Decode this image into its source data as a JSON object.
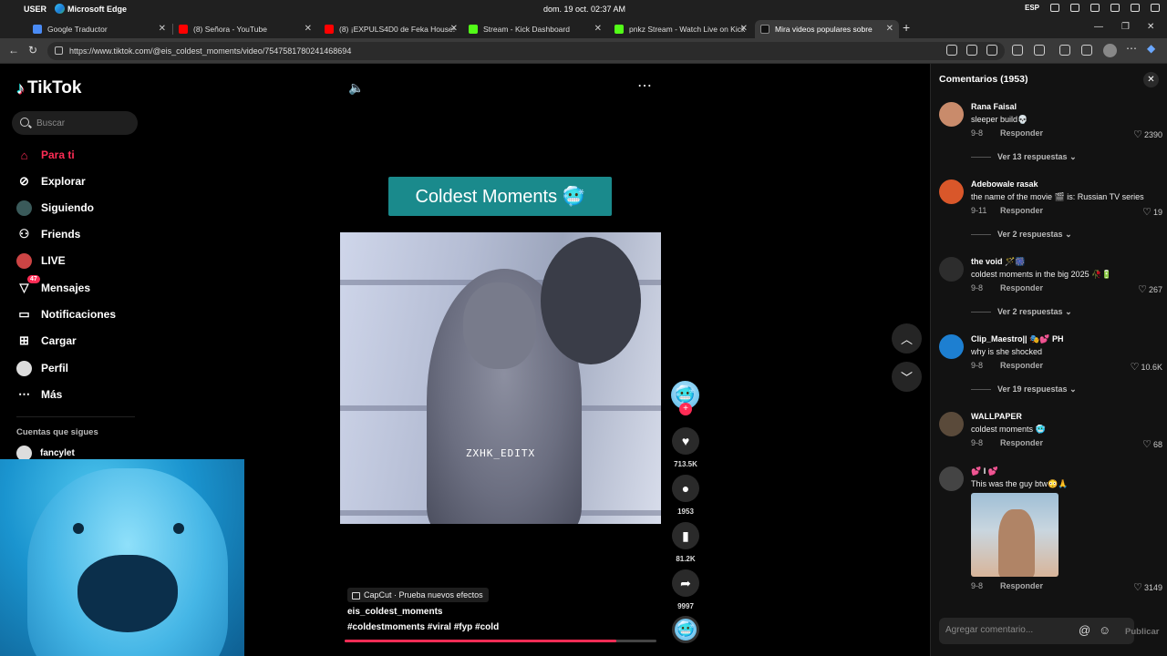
{
  "taskbar": {
    "user": "USER",
    "app": "Microsoft Edge",
    "datetime": "dom. 19 oct. 02:37 AM",
    "lang": "ESP"
  },
  "tabs": [
    {
      "label": "Google Traductor",
      "color": "#4a8bf5"
    },
    {
      "label": "(8) Señora - YouTube",
      "color": "#ff0000"
    },
    {
      "label": "(8) ¡EXPULS4D0 de Feka House!",
      "color": "#ff0000"
    },
    {
      "label": "Stream - Kick Dashboard",
      "color": "#53fc18"
    },
    {
      "label": "pnkz Stream - Watch Live on Kick",
      "color": "#53fc18"
    },
    {
      "label": "Mira videos populares sobre",
      "color": "#111111"
    }
  ],
  "address": {
    "url": "https://www.tiktok.com/@eis_coldest_moments/video/7547581780241468694"
  },
  "sidebar": {
    "brand": "TikTok",
    "search_placeholder": "Buscar",
    "items": [
      {
        "label": "Para ti",
        "icon": "home-icon"
      },
      {
        "label": "Explorar",
        "icon": "compass-icon"
      },
      {
        "label": "Siguiendo",
        "icon": "following-icon"
      },
      {
        "label": "Friends",
        "icon": "friends-icon"
      },
      {
        "label": "LIVE",
        "icon": "live-icon"
      },
      {
        "label": "Mensajes",
        "icon": "messages-icon",
        "badge": "47"
      },
      {
        "label": "Notificaciones",
        "icon": "inbox-icon"
      },
      {
        "label": "Cargar",
        "icon": "upload-icon"
      },
      {
        "label": "Perfil",
        "icon": "profile-icon"
      },
      {
        "label": "Más",
        "icon": "more-icon"
      }
    ],
    "following_heading": "Cuentas que sigues",
    "following": [
      {
        "name": "fancylet"
      }
    ]
  },
  "video": {
    "title_overlay": "Coldest Moments 🥶",
    "watermark": "ZXHK_EDITX",
    "effect": "CapCut · Prueba nuevos efectos",
    "author": "eis_coldest_moments",
    "hashtags": "#coldestmoments  #viral  #fyp  #cold",
    "progress": 0.87
  },
  "actions": {
    "likes": "713.5K",
    "comments": "1953",
    "saves": "81.2K",
    "shares": "9997"
  },
  "comments": {
    "header": "Comentarios (1953)",
    "reply_label": "Responder",
    "items": [
      {
        "name": "Rana Faisal",
        "text": "sleeper build💀",
        "date": "9-8",
        "likes": "2390",
        "more": "Ver 13 respuestas",
        "avatar": "#c98b6b"
      },
      {
        "name": "Adebowale rasak",
        "text": "the name of the movie 🎬 is: Russian TV series",
        "date": "9-11",
        "likes": "19",
        "more": "Ver 2 respuestas",
        "avatar": "#d9572a"
      },
      {
        "name": "the void 🪄🎆",
        "text": "coldest moments in the big 2025 🥀🔋",
        "date": "9-8",
        "likes": "267",
        "more": "Ver 2 respuestas",
        "avatar": "#2d2d2d"
      },
      {
        "name": "Clip_Maestro|| 🎭💕 PH",
        "text": "why is she shocked",
        "date": "9-8",
        "likes": "10.6K",
        "more": "Ver 19 respuestas",
        "avatar": "#1d7fd1"
      },
      {
        "name": "WALLPAPER",
        "text": "coldest moments 🥶",
        "date": "9-8",
        "likes": "68",
        "more": "",
        "avatar": "#5a4a3a"
      },
      {
        "name": "💕 I 💕",
        "text": "This was the guy btw😳🙏",
        "date": "9-8",
        "likes": "3149",
        "more": "",
        "avatar": "#444444"
      }
    ],
    "input_placeholder": "Agregar comentario...",
    "publish": "Publicar"
  }
}
